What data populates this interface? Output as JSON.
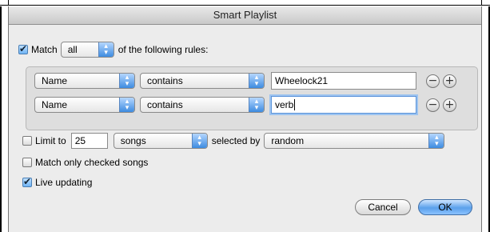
{
  "window": {
    "title": "Smart Playlist"
  },
  "match": {
    "label": "Match",
    "mode": "all",
    "suffix": "of the following rules:"
  },
  "rules": [
    {
      "field": "Name",
      "operator": "contains",
      "value": "Wheelock21"
    },
    {
      "field": "Name",
      "operator": "contains",
      "value": "verb"
    }
  ],
  "limit": {
    "label": "Limit to",
    "value": "25",
    "unit": "songs",
    "selected_by_label": "selected by",
    "selected_by": "random"
  },
  "match_checked": {
    "label": "Match only checked songs"
  },
  "live_updating": {
    "label": "Live updating"
  },
  "buttons": {
    "cancel": "Cancel",
    "ok": "OK"
  }
}
